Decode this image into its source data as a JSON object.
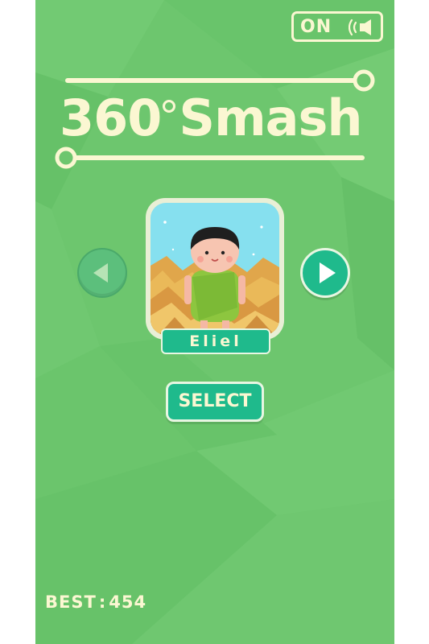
{
  "game": {
    "title_number": "360",
    "title_word": "Smash"
  },
  "sound": {
    "state_label": "ON",
    "icon": "speaker-icon"
  },
  "character": {
    "name": "Eliel"
  },
  "buttons": {
    "select_label": "SELECT",
    "prev_icon": "triangle-left-icon",
    "next_icon": "triangle-right-icon"
  },
  "score": {
    "best_label": "BEST",
    "separator": ":",
    "best_value": "454"
  },
  "colors": {
    "background": "#6dc66e",
    "accent": "#1fba8c",
    "cream_text": "#fbf7d2"
  }
}
